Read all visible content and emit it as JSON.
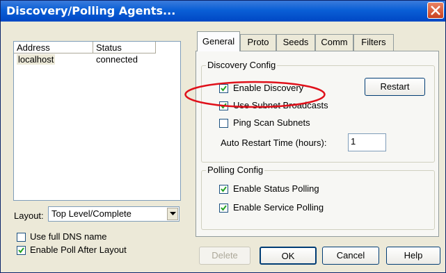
{
  "window": {
    "title": "Discovery/Polling Agents..."
  },
  "agents": {
    "columns": [
      "Address",
      "Status"
    ],
    "rows": [
      {
        "address": "localhost",
        "status": "connected"
      }
    ]
  },
  "layout": {
    "label": "Layout:",
    "selected": "Top Level/Complete"
  },
  "options": {
    "use_full_dns": {
      "label": "Use full DNS name",
      "checked": false
    },
    "enable_poll_after_layout": {
      "label": "Enable Poll After Layout",
      "checked": true
    }
  },
  "tabs": [
    "General",
    "Proto",
    "Seeds",
    "Comm",
    "Filters"
  ],
  "active_tab": "General",
  "discovery_config": {
    "title": "Discovery Config",
    "enable_discovery": {
      "label": "Enable Discovery",
      "checked": true
    },
    "use_subnet_broadcasts": {
      "label": "Use Subnet Broadcasts",
      "checked": true
    },
    "ping_scan_subnets": {
      "label": "Ping Scan Subnets",
      "checked": false
    },
    "auto_restart_label": "Auto Restart Time (hours):",
    "auto_restart_value": "1",
    "restart_button": "Restart"
  },
  "polling_config": {
    "title": "Polling Config",
    "enable_status_polling": {
      "label": "Enable Status Polling",
      "checked": true
    },
    "enable_service_polling": {
      "label": "Enable Service Polling",
      "checked": true
    }
  },
  "buttons": {
    "delete": "Delete",
    "ok": "OK",
    "cancel": "Cancel",
    "help": "Help"
  },
  "colors": {
    "title_bar": "#0a5fd6",
    "annotation": "#e0101a",
    "window_bg": "#ece9d8"
  }
}
